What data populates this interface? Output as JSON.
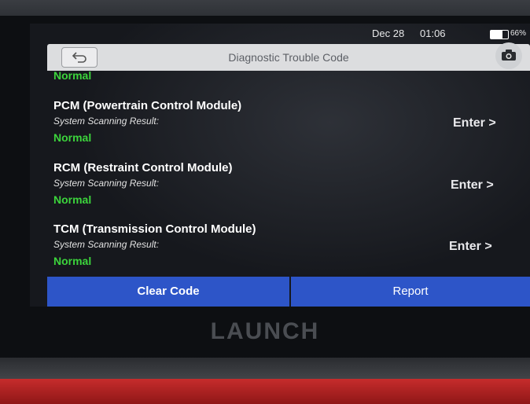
{
  "status_bar": {
    "date": "Dec 28",
    "time": "01:06",
    "battery_percent_text": "66%",
    "battery_level": 0.66
  },
  "header": {
    "title": "Diagnostic Trouble Code"
  },
  "partial_item": {
    "status": "Normal"
  },
  "modules": [
    {
      "name": "PCM (Powertrain Control Module)",
      "result_label": "System Scanning Result:",
      "status": "Normal",
      "action": "Enter >"
    },
    {
      "name": "RCM (Restraint Control Module)",
      "result_label": "System Scanning Result:",
      "status": "Normal",
      "action": "Enter >"
    },
    {
      "name": "TCM (Transmission Control Module)",
      "result_label": "System Scanning Result:",
      "status": "Normal",
      "action": "Enter >"
    }
  ],
  "buttons": {
    "clear_code": "Clear Code",
    "report": "Report"
  },
  "device": {
    "brand": "LAUNCH"
  },
  "colors": {
    "accent_blue": "#2d55c8",
    "status_green": "#3cd43c",
    "title_bar": "#dcdddf",
    "case_red": "#c62c2c"
  },
  "icons": [
    "back-arrow-icon",
    "camera-icon",
    "battery-icon"
  ]
}
